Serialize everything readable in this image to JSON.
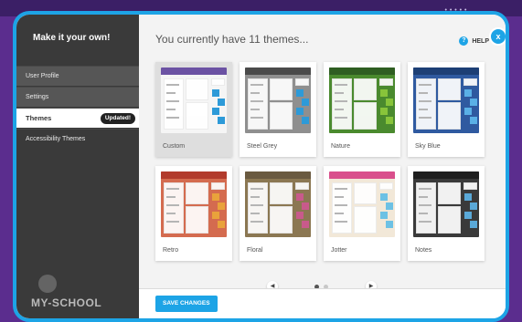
{
  "sidebar": {
    "title": "Make it your own!",
    "items": [
      {
        "label": "User Profile"
      },
      {
        "label": "Settings"
      },
      {
        "label": "Themes",
        "badge": "Updated!"
      },
      {
        "label": "Accessibility Themes"
      }
    ],
    "logo_text": "MY-SCHOOL"
  },
  "main": {
    "heading": "You currently have 11 themes...",
    "help_label": "HELP",
    "help_icon_glyph": "?",
    "close_glyph": "x"
  },
  "themes": [
    {
      "name": "Custom",
      "selected": true,
      "bar": "#6b52a3",
      "bg": "#f5f5f5",
      "accent": "#2d9ad8"
    },
    {
      "name": "Steel Grey",
      "selected": false,
      "bar": "#4a4a4a",
      "bg": "#8f8f8f",
      "accent": "#2d9ad8"
    },
    {
      "name": "Nature",
      "selected": false,
      "bar": "#2f5e22",
      "bg": "#4a8a2e",
      "accent": "#88c43a"
    },
    {
      "name": "Sky Blue",
      "selected": false,
      "bar": "#1d3f75",
      "bg": "#2f5aa0",
      "accent": "#5ab0e6"
    },
    {
      "name": "Retro",
      "selected": false,
      "bar": "#b23b2c",
      "bg": "#d46b4f",
      "accent": "#e9a23b"
    },
    {
      "name": "Floral",
      "selected": false,
      "bar": "#6a5a40",
      "bg": "#8b7752",
      "accent": "#c85a8b"
    },
    {
      "name": "Jotter",
      "selected": false,
      "bar": "#d94f8c",
      "bg": "#f2e8d8",
      "accent": "#6dc1e4"
    },
    {
      "name": "Notes",
      "selected": false,
      "bar": "#1f1f1f",
      "bg": "#3a3a3a",
      "accent": "#5aa9d8"
    }
  ],
  "pager": {
    "prev_glyph": "◀",
    "next_glyph": "▶",
    "pages": 2,
    "current_page": 1
  },
  "footer": {
    "save_label": "SAVE CHANGES"
  },
  "colors": {
    "accent": "#1da4e6",
    "background": "#5b2d8e",
    "sidebar": "#3a3a3a"
  }
}
